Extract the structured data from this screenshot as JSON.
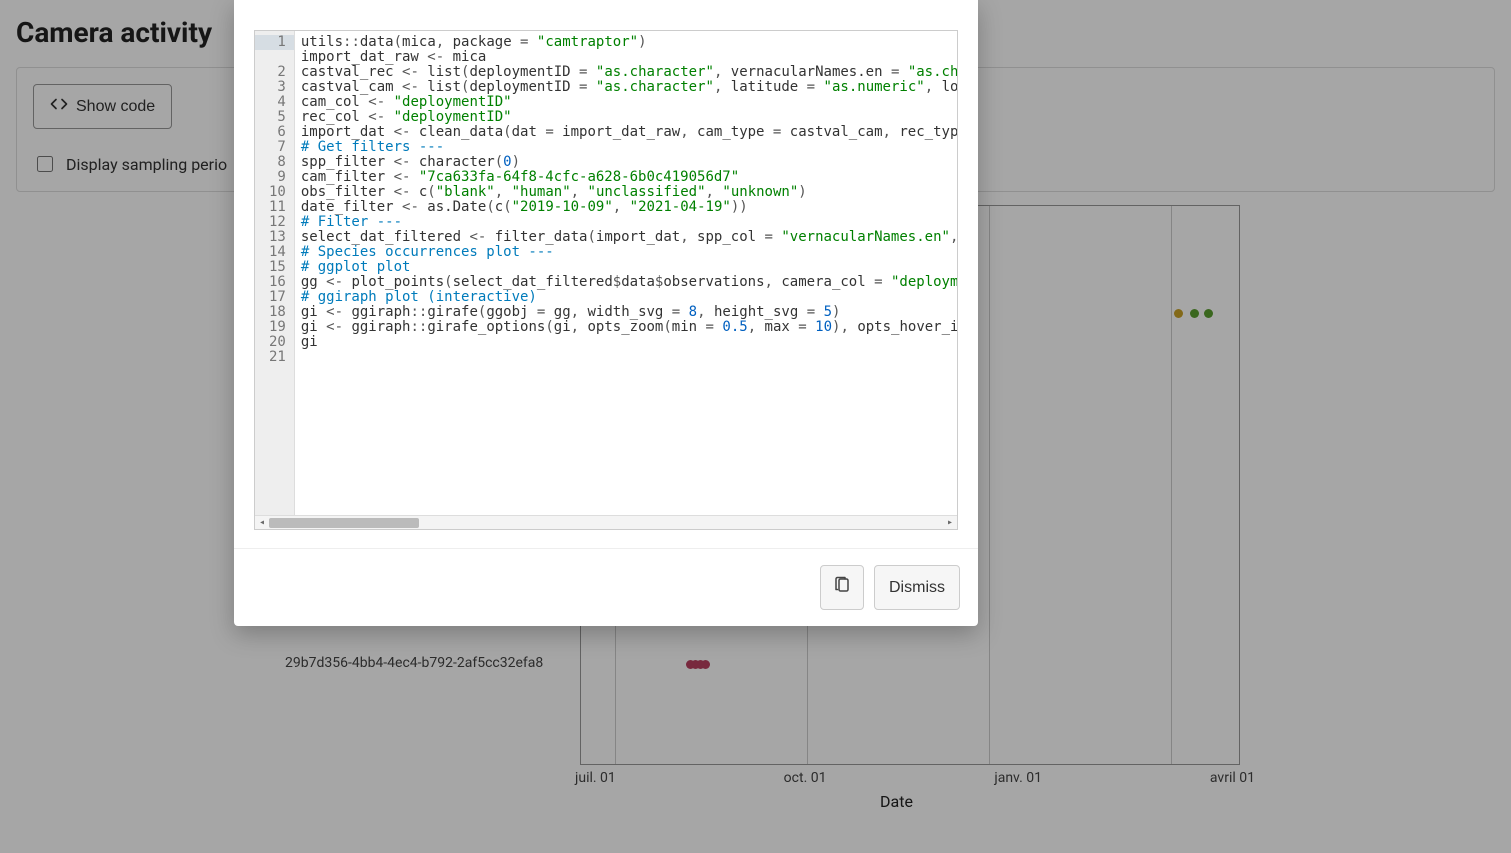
{
  "header": {
    "title": "Camera activity"
  },
  "toolbar": {
    "show_code_label": "Show code"
  },
  "options": {
    "display_sampling_label": "Display sampling perio"
  },
  "chart_ctx": {
    "x_axis_title": "Date",
    "x_ticks": [
      "juil. 01",
      "oct. 01",
      "janv. 01",
      "avril 01"
    ],
    "y_visible_label": "29b7d356-4bb4-4ec4-b792-2af5cc32efa8"
  },
  "chart_data": {
    "type": "scatter",
    "title": "",
    "xlabel": "Date",
    "ylabel": "",
    "note": "most of the plot is obscured by the modal; only two point clusters are visible",
    "x_ticks": [
      "juil. 01",
      "oct. 01",
      "janv. 01",
      "avril 01"
    ],
    "visible_points": [
      {
        "y_category": "29b7d356-4bb4-4ec4-b792-2af5cc32efa8",
        "x_approx": "mid-juillet",
        "count_estimate": 4,
        "color": "#b94060"
      },
      {
        "y_category": "(row obscured)",
        "x_approx": "late-mars",
        "count_estimate": 3,
        "colors": [
          "#c9a227",
          "#5a9e2f",
          "#5a9e2f"
        ]
      }
    ]
  },
  "modal": {
    "dismiss_label": "Dismiss",
    "code_lines": [
      "utils::data(mica, package = \"camtraptor\")",
      "import_dat_raw <- mica",
      "castval_rec <- list(deploymentID = \"as.character\", vernacularNames.en = \"as.character\",",
      "castval_cam <- list(deploymentID = \"as.character\", latitude = \"as.numeric\", longitude =",
      "cam_col <- \"deploymentID\"",
      "rec_col <- \"deploymentID\"",
      "import_dat <- clean_data(dat = import_dat_raw, cam_type = castval_cam, rec_type = castv",
      "# Get filters ---",
      "spp_filter <- character(0)",
      "cam_filter <- \"7ca633fa-64f8-4cfc-a628-6b0c419056d7\"",
      "obs_filter <- c(\"blank\", \"human\", \"unclassified\", \"unknown\")",
      "date_filter <- as.Date(c(\"2019-10-09\", \"2021-04-19\"))",
      "# Filter ---",
      "select_dat_filtered <- filter_data(import_dat, spp_col = \"vernacularNames.en\", spp_filt",
      "# Species occurrences plot ---",
      "# ggplot plot",
      "gg <- plot_points(select_dat_filtered$data$observations, camera_col = \"deploymentID\", p",
      "# ggiraph plot (interactive)",
      "gi <- ggiraph::girafe(ggobj = gg, width_svg = 8, height_svg = 5)",
      "gi <- ggiraph::girafe_options(gi, opts_zoom(min = 0.5, max = 10), opts_hover_inv(css = ",
      "gi"
    ]
  }
}
